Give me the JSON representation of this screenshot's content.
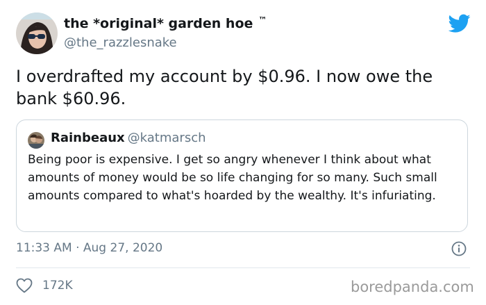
{
  "author": {
    "display_name": "the *original* garden hoe",
    "tm": "™",
    "handle": "@the_razzlesnake"
  },
  "tweet": {
    "text": "I overdrafted my account by $0.96. I now owe the bank $60.96.",
    "timestamp": "11:33 AM · Aug 27, 2020",
    "likes": "172K"
  },
  "quoted": {
    "name": "Rainbeaux",
    "handle": "@katmarsch",
    "text": "Being poor is expensive. I get so angry whenever I think about what amounts of money would be so life changing for so many. Such small amounts compared to what's hoarded by the wealthy. It's infuriating."
  },
  "icons": {
    "logo": "twitter-bird-icon",
    "like": "heart-icon",
    "info": "info-icon"
  },
  "colors": {
    "twitter_blue": "#1da1f2",
    "secondary_text": "#657786",
    "border": "#ccd6dd"
  },
  "watermark": "boredpanda.com"
}
